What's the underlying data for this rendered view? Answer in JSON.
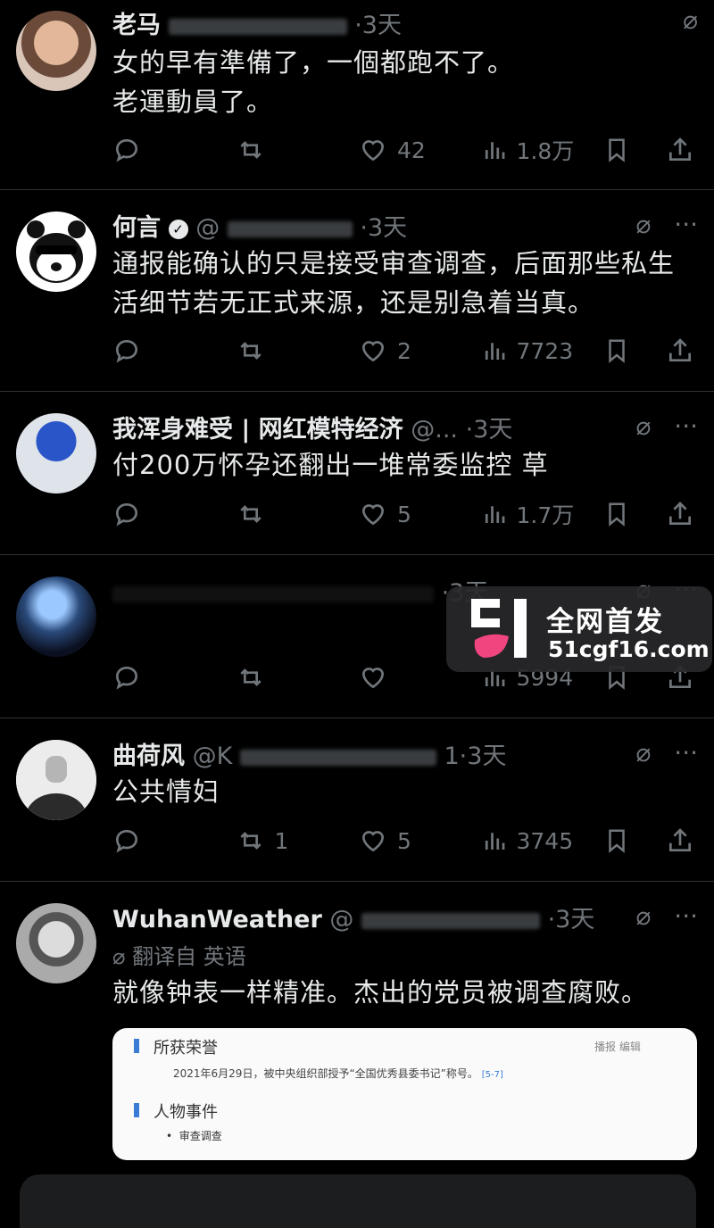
{
  "tweets": [
    {
      "name": "老马",
      "time": "·3天",
      "body": [
        "女的早有準備了，一個都跑不了。",
        "老運動員了。"
      ],
      "reply": "",
      "retweet": "",
      "like": "42",
      "views": "1.8万"
    },
    {
      "name": "何言",
      "handle": "@",
      "time": "·3天",
      "body": [
        "通报能确认的只是接受审查调查，后面那些私生",
        "活细节若无正式来源，还是别急着当真。"
      ],
      "reply": "",
      "retweet": "",
      "like": "2",
      "views": "7723"
    },
    {
      "name": "我浑身难受 | 网红模特经济",
      "handle": "@...",
      "time": "·3天",
      "body": [
        "付200万怀孕还翻出一堆常委监控 草"
      ],
      "reply": "",
      "retweet": "",
      "like": "5",
      "views": "1.7万"
    },
    {
      "name": "",
      "time": "·3天",
      "body": [],
      "reply": "",
      "retweet": "",
      "like": "",
      "views": "5994"
    },
    {
      "name": "曲荷风",
      "handle": "@K",
      "time": "1·3天",
      "body": [
        "公共情妇"
      ],
      "reply": "",
      "retweet": "1",
      "like": "5",
      "views": "3745"
    },
    {
      "name": "WuhanWeather",
      "handle": "@",
      "time": "·3天",
      "translated": "翻译自 英语",
      "body": [
        "就像钟表一样精准。杰出的党员被调查腐败。"
      ]
    }
  ],
  "card": {
    "section1": "所获荣誉",
    "section1_text": "2021年6月29日，被中央组织部授予“全国优秀县委书记”称号。",
    "section1_link": "全国优秀县委书记",
    "cite": "[5-7]",
    "tools": "播报   编辑",
    "section2": "人物事件",
    "bullet": "审查调查"
  },
  "watermark": {
    "title": "全网首发",
    "url": "51cgf16.com"
  },
  "colors": {
    "background": "#000000",
    "text": "#e7e9ea",
    "muted": "#71767b",
    "divider": "#2f3336",
    "watermark_pink": "#f0457e"
  }
}
